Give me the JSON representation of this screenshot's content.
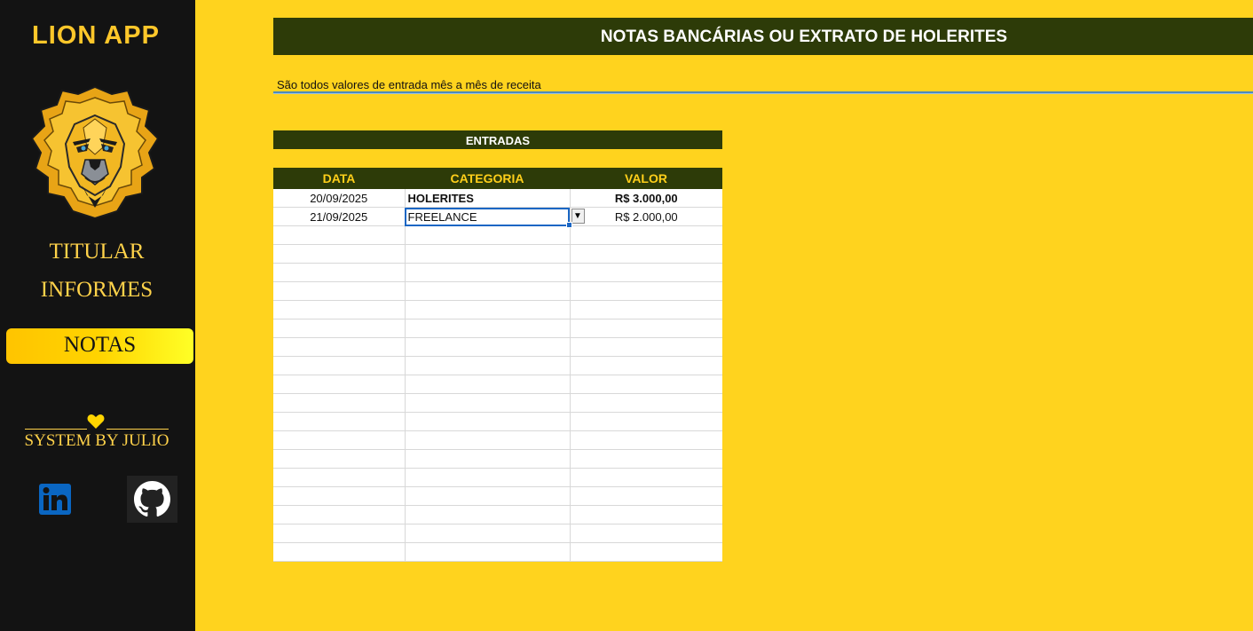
{
  "sidebar": {
    "app_title": "LION APP",
    "nav": [
      "TITULAR",
      "INFORMES",
      "NOTAS"
    ],
    "active_nav": "NOTAS",
    "credit": "SYSTEM BY JULIO",
    "social": [
      "linkedin-icon",
      "github-icon"
    ]
  },
  "main": {
    "header": "NOTAS BANCÁRIAS OU EXTRATO DE HOLERITES",
    "subtitle": "São todos valores de entrada mês a mês de receita",
    "section_title": "ENTRADAS",
    "columns": [
      "DATA",
      "CATEGORIA",
      "VALOR"
    ],
    "rows": [
      [
        "20/09/2025",
        "HOLERITES",
        "R$ 3.000,00"
      ],
      [
        "21/09/2025",
        "FREELANCE",
        "R$ 2.000,00"
      ],
      [
        "",
        "",
        ""
      ],
      [
        "",
        "",
        ""
      ],
      [
        "",
        "",
        ""
      ],
      [
        "",
        "",
        ""
      ],
      [
        "",
        "",
        ""
      ],
      [
        "",
        "",
        ""
      ],
      [
        "",
        "",
        ""
      ],
      [
        "",
        "",
        ""
      ],
      [
        "",
        "",
        ""
      ],
      [
        "",
        "",
        ""
      ],
      [
        "",
        "",
        ""
      ],
      [
        "",
        "",
        ""
      ],
      [
        "",
        "",
        ""
      ],
      [
        "",
        "",
        ""
      ],
      [
        "",
        "",
        ""
      ],
      [
        "",
        "",
        ""
      ],
      [
        "",
        "",
        ""
      ],
      [
        "",
        "",
        ""
      ]
    ]
  },
  "colors": {
    "background": "#ffd31e",
    "sidebar": "#131313",
    "header_bar": "#2d3b08",
    "accent_text": "#ffc72a",
    "selection": "#1a66c4"
  }
}
